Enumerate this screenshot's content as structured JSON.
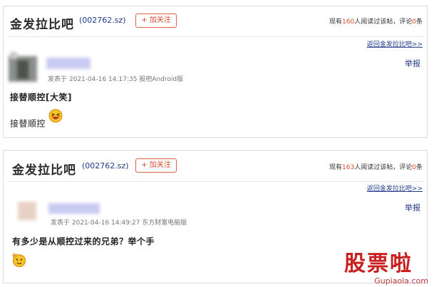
{
  "posts": [
    {
      "forum_name": "金发拉比吧",
      "stock_code": "(002762.sz)",
      "follow_label": "+ 加关注",
      "readers": {
        "prefix": "现有",
        "count": "160",
        "middle": "人阅读过该帖，评论",
        "comments": "0",
        "suffix": "条"
      },
      "back_link": "返回金发拉比吧>>",
      "report_label": "举报",
      "meta": "发表于 2021-04-16 14:17:35 股吧Android版",
      "title": "接替顺控[大笑]",
      "body": "接替顺控",
      "emoji": "laughing-emoji-icon"
    },
    {
      "forum_name": "金发拉比吧",
      "stock_code": "(002762.sz)",
      "follow_label": "+ 加关注",
      "readers": {
        "prefix": "现有",
        "count": "163",
        "middle": "人阅读过该帖，评论",
        "comments": "0",
        "suffix": "条"
      },
      "back_link": "返回金发拉比吧>>",
      "report_label": "举报",
      "meta": "发表于 2021-04-16 14:49:27 东方财富电脑版",
      "title": "有多少是从顺控过来的兄弟？举个手",
      "body": "",
      "emoji": "raise-hand-emoji-icon"
    }
  ],
  "watermark": {
    "text": "股票啦",
    "url": "Gupiaola.com"
  },
  "colors": {
    "link": "#1f3a8a",
    "accent": "#e04a2a",
    "border": "#dcdcdc",
    "watermark": "#c81f1f"
  }
}
